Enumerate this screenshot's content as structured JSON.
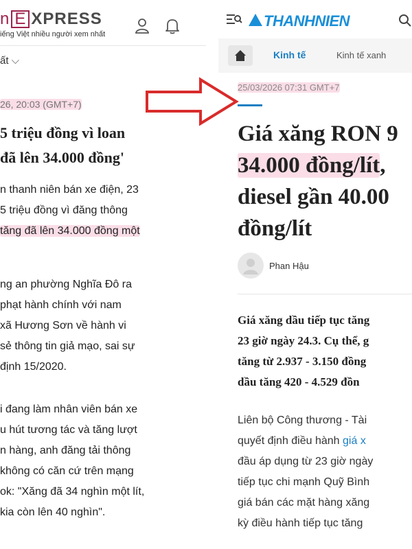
{
  "left": {
    "logo_left": "n",
    "logo_mid": "E",
    "logo_right": "XPRESS",
    "tagline": "iếng Việt nhiều người xem nhất",
    "nav_label": "ất",
    "datetime": "26, 20:03 (GMT+7)",
    "title_lines": [
      "5 triệu đồng vì loan",
      "đã lên 34.000 đồng'"
    ],
    "lead_lines": [
      "n thanh niên bán xe điện, 23",
      "5 triệu đồng vì đăng thông"
    ],
    "lead_highlight": "tăng đã lên 34.000 đồng một",
    "body_para1": [
      "ng an phường Nghĩa Đô ra",
      "phạt hành chính với nam",
      "xã Hương Sơn về hành vi",
      "sẻ thông tin giả mạo, sai sự",
      "định 15/2020."
    ],
    "body_para2": [
      "i đang làm nhân viên bán xe",
      "u hút tương tác và tăng lượt",
      "n hàng, anh đăng tải thông",
      "không có căn cứ trên mạng",
      "ok: \"Xăng đã 34 nghìn một lít,",
      "kia còn lên 40 nghìn\"."
    ]
  },
  "right": {
    "logo": "THANHNIEN",
    "nav_active": "Kinh tế",
    "nav_other": "Kinh tế xanh",
    "datetime": "25/03/2026 07:31 GMT+7",
    "title_line1": "Giá xăng RON 9",
    "title_line2_hl": "34.000 đồng/lít",
    "title_line2_rest": ",",
    "title_line3": "diesel gần 40.00",
    "title_line4": "đồng/lít",
    "author": "Phan Hậu",
    "lead_lines": [
      "Giá xăng dầu tiếp tục tăng",
      "23 giờ ngày 24.3. Cụ thể, g",
      "tăng từ 2.937 - 3.150 đồng",
      "dầu tăng 420 - 4.529 đồn"
    ],
    "body_line1": "Liên bộ Công thương - Tài",
    "body_line2_pre": "quyết định điều hành ",
    "body_line2_link": "giá x",
    "body_lines_rest": [
      "đầu áp dụng từ 23 giờ ngày",
      "tiếp tục chi mạnh Quỹ Bình",
      "giá bán các mặt hàng xăng",
      "kỳ điều hành tiếp tục tăng"
    ]
  },
  "colors": {
    "vne_brand": "#9f224e",
    "tn_blue": "#1b7fc2",
    "highlight": "#f4b6c9",
    "arrow": "#d92b2b"
  }
}
